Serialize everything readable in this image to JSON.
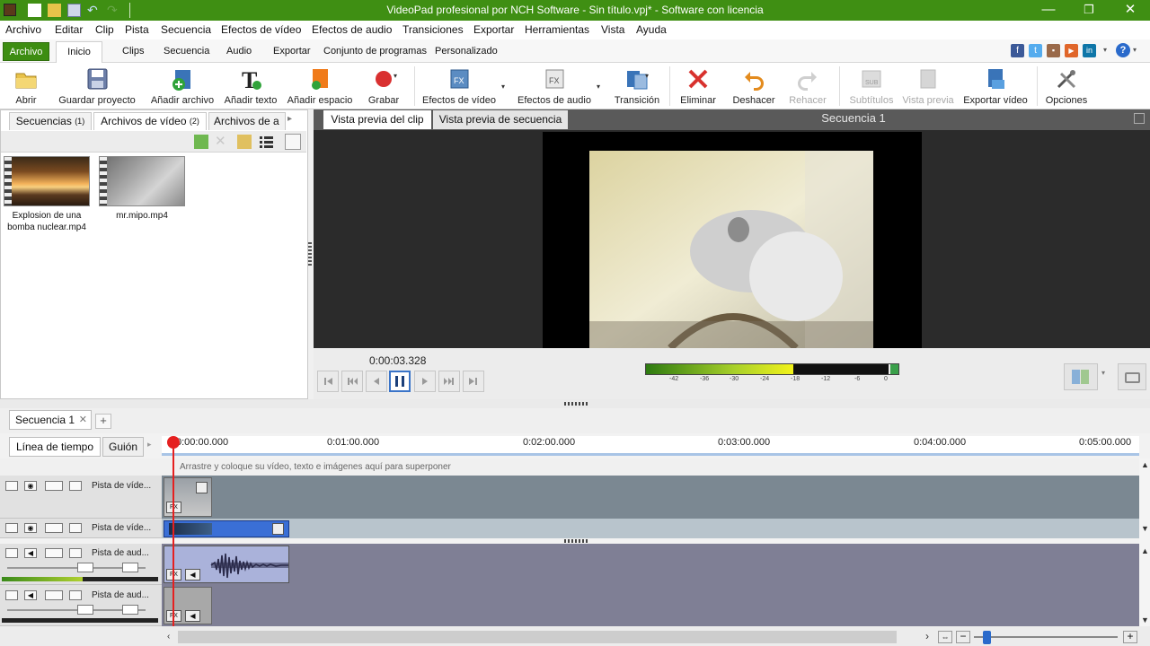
{
  "window": {
    "title": "VideoPad profesional por NCH Software - Sin título.vpj* - Software con licencia",
    "minimize": "—",
    "maximize": "❐",
    "close": "✕"
  },
  "menu": [
    "Archivo",
    "Editar",
    "Clip",
    "Pista",
    "Secuencia",
    "Efectos de vídeo",
    "Efectos de audio",
    "Transiciones",
    "Exportar",
    "Herramientas",
    "Vista",
    "Ayuda"
  ],
  "ribbon_tabs": {
    "archivo": "Archivo",
    "inicio": "Inicio",
    "others": [
      "Clips",
      "Secuencia",
      "Audio",
      "Exportar",
      "Conjunto de programas",
      "Personalizado"
    ]
  },
  "social": [
    {
      "name": "facebook",
      "color": "#3b5998",
      "glyph": "f"
    },
    {
      "name": "twitter",
      "color": "#55acee",
      "glyph": "t"
    },
    {
      "name": "flickr",
      "color": "#9a6a4a",
      "glyph": "▪"
    },
    {
      "name": "youtube",
      "color": "#e0662a",
      "glyph": "▶"
    },
    {
      "name": "linkedin",
      "color": "#0e76a8",
      "glyph": "in"
    }
  ],
  "toolbar": {
    "abrir": "Abrir",
    "guardar": "Guardar proyecto",
    "anadir_archivo": "Añadir archivo",
    "anadir_texto": "Añadir texto",
    "anadir_espacio": "Añadir espacio",
    "grabar": "Grabar",
    "efectos_video": "Efectos de vídeo",
    "efectos_audio": "Efectos de audio",
    "transicion": "Transición",
    "eliminar": "Eliminar",
    "deshacer": "Deshacer",
    "rehacer": "Rehacer",
    "subtitulos": "Subtítulos",
    "vista_previa": "Vista previa",
    "exportar_video": "Exportar vídeo",
    "opciones": "Opciones"
  },
  "bin_tabs": [
    {
      "label": "Secuencias",
      "count": "(1)"
    },
    {
      "label": "Archivos de vídeo",
      "count": "(2)"
    },
    {
      "label": "Archivos de a",
      "count": ""
    }
  ],
  "bin_files": [
    {
      "name": "Explosion de una bomba nuclear.mp4"
    },
    {
      "name": "mr.mipo.mp4"
    }
  ],
  "preview": {
    "tab_clip": "Vista previa del clip",
    "tab_sequence": "Vista previa de secuencia",
    "sequence_label": "Secuencia 1",
    "timecode": "0:00:03.328",
    "meter_ticks": [
      "-42",
      "-36",
      "-30",
      "-24",
      "-18",
      "-12",
      "-6",
      "0"
    ]
  },
  "sequence_tab": "Secuencia 1",
  "timeline": {
    "tab_timeline": "Línea de tiempo",
    "tab_storyboard": "Guión",
    "ruler": [
      "0:00:00.000",
      "0:01:00.000",
      "0:02:00.000",
      "0:03:00.000",
      "0:04:00.000",
      "0:05:00.000"
    ],
    "overlay_hint": "Arrastre y coloque su vídeo, texto e imágenes aquí para superponer",
    "video_tracks": [
      "Pista de víde...",
      "Pista de víde..."
    ],
    "audio_tracks": [
      "Pista de aud...",
      "Pista de aud..."
    ]
  },
  "colors": {
    "title_bar": "#3f8f13",
    "accent_green": "#3d8d12",
    "preview_bg": "#2b2b2b",
    "playhead": "#e52020",
    "video_track": "#7b8892",
    "audio_track": "#7f7f95",
    "clip_blue": "#3a6fd6"
  }
}
